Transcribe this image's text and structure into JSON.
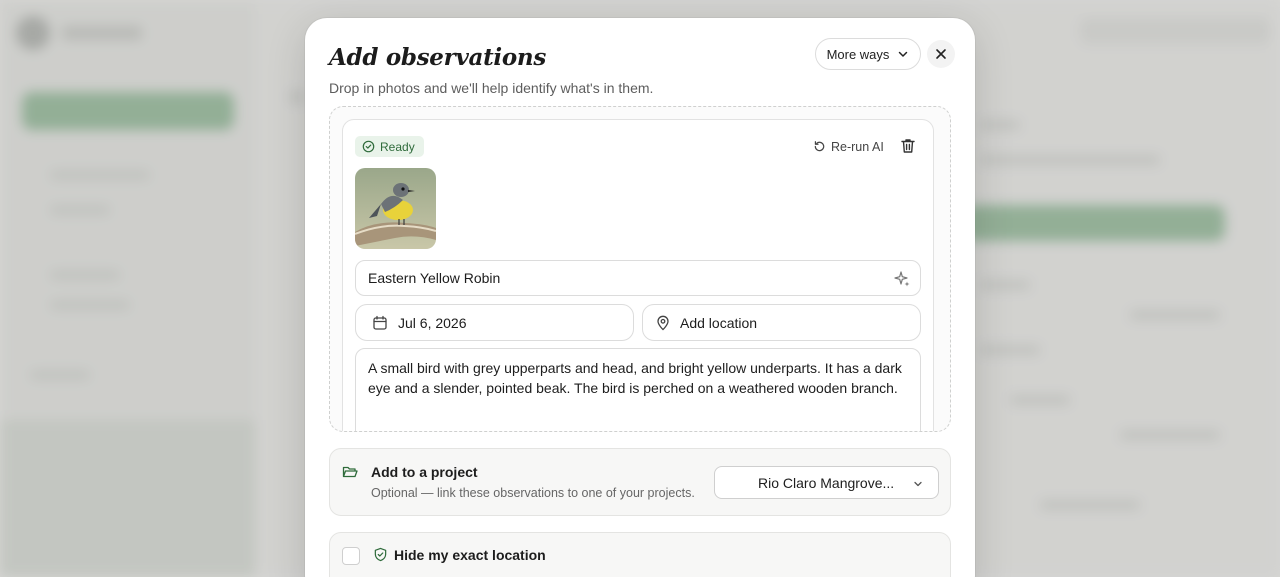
{
  "modal": {
    "title": "Add observations",
    "subtitle": "Drop in photos and we'll help identify what's in them.",
    "more_ways_label": "More ways",
    "close_icon": "close-icon"
  },
  "observation": {
    "status_label": "Ready",
    "rerun_label": "Re-run AI",
    "species": "Eastern Yellow Robin",
    "date": "Jul 6, 2026",
    "location_label": "Add location",
    "description": "A small bird with grey upperparts and head, and bright yellow underparts. It has a dark eye and a slender, pointed beak. The bird is perched on a weathered wooden branch."
  },
  "project": {
    "title": "Add to a project",
    "help": "Optional — link these observations to one of your projects.",
    "selected": "Rio Claro Mangrove..."
  },
  "privacy": {
    "title": "Hide my exact location"
  },
  "colors": {
    "accent_green": "#2f6b3b",
    "status_bg": "#e9f3ea"
  }
}
